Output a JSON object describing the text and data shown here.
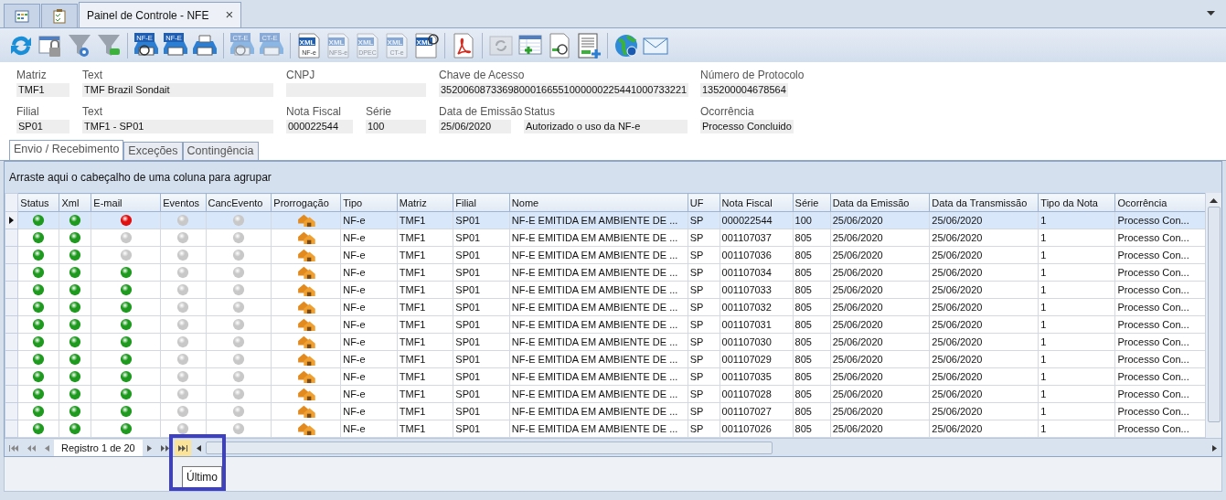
{
  "doc_tabs": [
    {
      "kind": "grid",
      "selected": false
    },
    {
      "kind": "checklist",
      "selected": false
    },
    {
      "kind": "text",
      "label": "Painel de Controle - NFE",
      "selected": true,
      "close": "×"
    }
  ],
  "toolbar": [
    {
      "kind": "refresh",
      "disabled": false
    },
    {
      "kind": "lock",
      "disabled": false
    },
    {
      "kind": "filter-gear",
      "disabled": false
    },
    {
      "kind": "filter-eraser",
      "disabled": false
    },
    {
      "kind": "sep"
    },
    {
      "kind": "printer-search",
      "label": "NF-E",
      "disabled": false
    },
    {
      "kind": "printer",
      "label": "NF-E",
      "disabled": false
    },
    {
      "kind": "printer",
      "disabled": false
    },
    {
      "kind": "sep"
    },
    {
      "kind": "printer-search",
      "label": "CT-E",
      "disabled": true
    },
    {
      "kind": "printer",
      "label": "CT-E",
      "disabled": true
    },
    {
      "kind": "sep"
    },
    {
      "kind": "xml",
      "label": "XML",
      "sub": "NF-e",
      "disabled": false
    },
    {
      "kind": "xml",
      "label": "XML",
      "sub": "NFS-e",
      "disabled": true
    },
    {
      "kind": "xml",
      "label": "XML",
      "sub": "DPEC",
      "disabled": true
    },
    {
      "kind": "xml",
      "label": "XML",
      "sub": "CT-e",
      "disabled": true
    },
    {
      "kind": "xml-search",
      "label": "XML",
      "disabled": false
    },
    {
      "kind": "sep"
    },
    {
      "kind": "pdf",
      "disabled": false
    },
    {
      "kind": "sep"
    },
    {
      "kind": "sync",
      "disabled": true
    },
    {
      "kind": "table-add",
      "disabled": false
    },
    {
      "kind": "doc-search",
      "disabled": false
    },
    {
      "kind": "list-add",
      "disabled": false
    },
    {
      "kind": "sep"
    },
    {
      "kind": "globe",
      "disabled": false
    },
    {
      "kind": "mail",
      "disabled": false
    }
  ],
  "header_fields": [
    [
      {
        "label": "Matriz",
        "value": "TMF1"
      },
      {
        "label": "Text",
        "value": "TMF Brazil Sondait"
      },
      {
        "label": "CNPJ"
      },
      {
        "label": "Chave de Acesso",
        "value": "35200608733698000166551000000225441000733221"
      },
      {
        "label": "Número de Protocolo",
        "value": "135200004678564"
      }
    ],
    [
      {
        "label": "Filial",
        "value": "SP01"
      },
      {
        "label": "Text",
        "value": "TMF1 - SP01"
      },
      {
        "label": "Nota Fiscal",
        "value": "000022544"
      },
      {
        "label": "Série",
        "value": "100"
      },
      {
        "label": "Data de Emissão",
        "value": "25/06/2020"
      },
      {
        "label": "Status",
        "value": "Autorizado o uso da NF-e"
      },
      {
        "label": "Ocorrência",
        "value": "Processo Concluido"
      }
    ]
  ],
  "tabs": [
    {
      "label": "Envio / Recebimento",
      "selected": true
    },
    {
      "label": "Exceções",
      "selected": false
    },
    {
      "label": "Contingência",
      "selected": false
    }
  ],
  "group_panel": "Arraste aqui o cabeçalho de uma coluna para agrupar",
  "table": {
    "columns": [
      "Status",
      "Xml",
      "E-mail",
      "Eventos",
      "CancEvento",
      "Prorrogação",
      "Tipo",
      "Matriz",
      "Filial",
      "Nome",
      "UF",
      "Nota Fiscal",
      "Série",
      "Data da Emissão",
      "Data da Transmissão",
      "Tipo da Nota",
      "Ocorrência"
    ],
    "rows": [
      {
        "selected": true,
        "lights": [
          {
            "color": "#1e9a1e"
          },
          {
            "color": "#1e9a1e"
          },
          {
            "color": "#e01010"
          },
          {
            "color": "#c8c8c8"
          },
          {
            "color": "#c8c8c8"
          }
        ],
        "values": [
          "NF-e",
          "TMF1",
          "SP01",
          "NF-E EMITIDA EM AMBIENTE DE ...",
          "SP",
          "000022544",
          "100",
          "25/06/2020",
          "25/06/2020",
          "1",
          "Processo Con..."
        ]
      },
      {
        "selected": false,
        "lights": [
          {
            "color": "#1e9a1e"
          },
          {
            "color": "#1e9a1e"
          },
          {
            "color": "#c8c8c8"
          },
          {
            "color": "#c8c8c8"
          },
          {
            "color": "#c8c8c8"
          }
        ],
        "values": [
          "NF-e",
          "TMF1",
          "SP01",
          "NF-E EMITIDA EM AMBIENTE DE ...",
          "SP",
          "001107037",
          "805",
          "25/06/2020",
          "25/06/2020",
          "1",
          "Processo Con..."
        ]
      },
      {
        "selected": false,
        "lights": [
          {
            "color": "#1e9a1e"
          },
          {
            "color": "#1e9a1e"
          },
          {
            "color": "#c8c8c8"
          },
          {
            "color": "#c8c8c8"
          },
          {
            "color": "#c8c8c8"
          }
        ],
        "values": [
          "NF-e",
          "TMF1",
          "SP01",
          "NF-E EMITIDA EM AMBIENTE DE ...",
          "SP",
          "001107036",
          "805",
          "25/06/2020",
          "25/06/2020",
          "1",
          "Processo Con..."
        ]
      },
      {
        "selected": false,
        "lights": [
          {
            "color": "#1e9a1e"
          },
          {
            "color": "#1e9a1e"
          },
          {
            "color": "#1e9a1e"
          },
          {
            "color": "#c8c8c8"
          },
          {
            "color": "#c8c8c8"
          }
        ],
        "values": [
          "NF-e",
          "TMF1",
          "SP01",
          "NF-E EMITIDA EM AMBIENTE DE ...",
          "SP",
          "001107034",
          "805",
          "25/06/2020",
          "25/06/2020",
          "1",
          "Processo Con..."
        ]
      },
      {
        "selected": false,
        "lights": [
          {
            "color": "#1e9a1e"
          },
          {
            "color": "#1e9a1e"
          },
          {
            "color": "#1e9a1e"
          },
          {
            "color": "#c8c8c8"
          },
          {
            "color": "#c8c8c8"
          }
        ],
        "values": [
          "NF-e",
          "TMF1",
          "SP01",
          "NF-E EMITIDA EM AMBIENTE DE ...",
          "SP",
          "001107033",
          "805",
          "25/06/2020",
          "25/06/2020",
          "1",
          "Processo Con..."
        ]
      },
      {
        "selected": false,
        "lights": [
          {
            "color": "#1e9a1e"
          },
          {
            "color": "#1e9a1e"
          },
          {
            "color": "#1e9a1e"
          },
          {
            "color": "#c8c8c8"
          },
          {
            "color": "#c8c8c8"
          }
        ],
        "values": [
          "NF-e",
          "TMF1",
          "SP01",
          "NF-E EMITIDA EM AMBIENTE DE ...",
          "SP",
          "001107032",
          "805",
          "25/06/2020",
          "25/06/2020",
          "1",
          "Processo Con..."
        ]
      },
      {
        "selected": false,
        "lights": [
          {
            "color": "#1e9a1e"
          },
          {
            "color": "#1e9a1e"
          },
          {
            "color": "#1e9a1e"
          },
          {
            "color": "#c8c8c8"
          },
          {
            "color": "#c8c8c8"
          }
        ],
        "values": [
          "NF-e",
          "TMF1",
          "SP01",
          "NF-E EMITIDA EM AMBIENTE DE ...",
          "SP",
          "001107031",
          "805",
          "25/06/2020",
          "25/06/2020",
          "1",
          "Processo Con..."
        ]
      },
      {
        "selected": false,
        "lights": [
          {
            "color": "#1e9a1e"
          },
          {
            "color": "#1e9a1e"
          },
          {
            "color": "#1e9a1e"
          },
          {
            "color": "#c8c8c8"
          },
          {
            "color": "#c8c8c8"
          }
        ],
        "values": [
          "NF-e",
          "TMF1",
          "SP01",
          "NF-E EMITIDA EM AMBIENTE DE ...",
          "SP",
          "001107030",
          "805",
          "25/06/2020",
          "25/06/2020",
          "1",
          "Processo Con..."
        ]
      },
      {
        "selected": false,
        "lights": [
          {
            "color": "#1e9a1e"
          },
          {
            "color": "#1e9a1e"
          },
          {
            "color": "#1e9a1e"
          },
          {
            "color": "#c8c8c8"
          },
          {
            "color": "#c8c8c8"
          }
        ],
        "values": [
          "NF-e",
          "TMF1",
          "SP01",
          "NF-E EMITIDA EM AMBIENTE DE ...",
          "SP",
          "001107029",
          "805",
          "25/06/2020",
          "25/06/2020",
          "1",
          "Processo Con..."
        ]
      },
      {
        "selected": false,
        "lights": [
          {
            "color": "#1e9a1e"
          },
          {
            "color": "#1e9a1e"
          },
          {
            "color": "#1e9a1e"
          },
          {
            "color": "#c8c8c8"
          },
          {
            "color": "#c8c8c8"
          }
        ],
        "values": [
          "NF-e",
          "TMF1",
          "SP01",
          "NF-E EMITIDA EM AMBIENTE DE ...",
          "SP",
          "001107035",
          "805",
          "25/06/2020",
          "25/06/2020",
          "1",
          "Processo Con..."
        ]
      },
      {
        "selected": false,
        "lights": [
          {
            "color": "#1e9a1e"
          },
          {
            "color": "#1e9a1e"
          },
          {
            "color": "#1e9a1e"
          },
          {
            "color": "#c8c8c8"
          },
          {
            "color": "#c8c8c8"
          }
        ],
        "values": [
          "NF-e",
          "TMF1",
          "SP01",
          "NF-E EMITIDA EM AMBIENTE DE ...",
          "SP",
          "001107028",
          "805",
          "25/06/2020",
          "25/06/2020",
          "1",
          "Processo Con..."
        ]
      },
      {
        "selected": false,
        "lights": [
          {
            "color": "#1e9a1e"
          },
          {
            "color": "#1e9a1e"
          },
          {
            "color": "#1e9a1e"
          },
          {
            "color": "#c8c8c8"
          },
          {
            "color": "#c8c8c8"
          }
        ],
        "values": [
          "NF-e",
          "TMF1",
          "SP01",
          "NF-E EMITIDA EM AMBIENTE DE ...",
          "SP",
          "001107027",
          "805",
          "25/06/2020",
          "25/06/2020",
          "1",
          "Processo Con..."
        ]
      },
      {
        "selected": false,
        "lights": [
          {
            "color": "#1e9a1e"
          },
          {
            "color": "#1e9a1e"
          },
          {
            "color": "#1e9a1e"
          },
          {
            "color": "#c8c8c8"
          },
          {
            "color": "#c8c8c8"
          }
        ],
        "values": [
          "NF-e",
          "TMF1",
          "SP01",
          "NF-E EMITIDA EM AMBIENTE DE ...",
          "SP",
          "001107026",
          "805",
          "25/06/2020",
          "25/06/2020",
          "1",
          "Processo Con..."
        ]
      }
    ]
  },
  "navigator": {
    "record": "Registro 1 de 20"
  },
  "tooltip": "Último"
}
